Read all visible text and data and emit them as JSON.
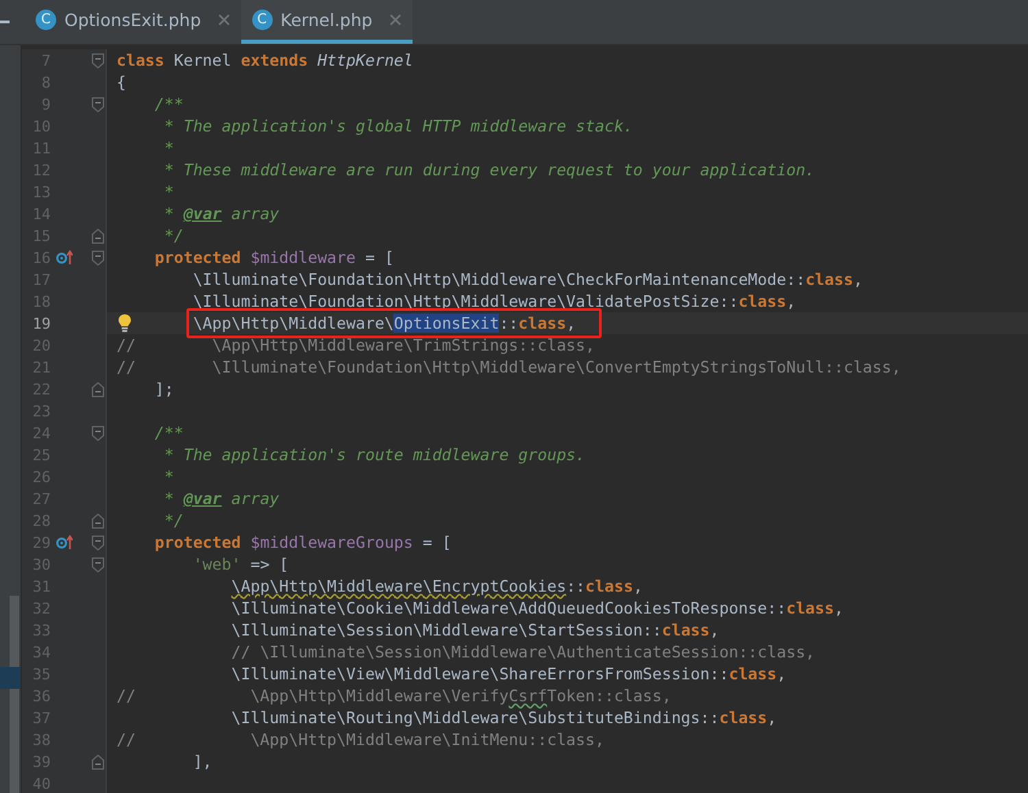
{
  "tabs": [
    {
      "icon_letter": "C",
      "label": "OptionsExit.php",
      "selected": false
    },
    {
      "icon_letter": "C",
      "label": "Kernel.php",
      "selected": true
    }
  ],
  "editor": {
    "lines": [
      {
        "number": "7",
        "fold_start": true,
        "tokens": [
          {
            "kind": "keyword",
            "text": "class"
          },
          {
            "kind": "plain",
            "text": " Kernel "
          },
          {
            "kind": "keyword",
            "text": "extends "
          },
          {
            "kind": "type",
            "text": "HttpKernel"
          }
        ]
      },
      {
        "number": "8",
        "tokens": [
          {
            "kind": "plain",
            "text": "{"
          }
        ]
      },
      {
        "number": "9",
        "fold_start": true,
        "tokens": [
          {
            "kind": "doc",
            "text": "    /**"
          }
        ]
      },
      {
        "number": "10",
        "tokens": [
          {
            "kind": "doc",
            "text": "     * The application's global HTTP middleware stack."
          }
        ]
      },
      {
        "number": "11",
        "tokens": [
          {
            "kind": "doc",
            "text": "     *"
          }
        ]
      },
      {
        "number": "12",
        "tokens": [
          {
            "kind": "doc",
            "text": "     * These middleware are run during every request to your application."
          }
        ]
      },
      {
        "number": "13",
        "tokens": [
          {
            "kind": "doc",
            "text": "     *"
          }
        ]
      },
      {
        "number": "14",
        "tokens": [
          {
            "kind": "doc",
            "text": "     * "
          },
          {
            "kind": "doctag",
            "text": "@var"
          },
          {
            "kind": "doc",
            "text": " array"
          }
        ]
      },
      {
        "number": "15",
        "fold_end": true,
        "tokens": [
          {
            "kind": "doc",
            "text": "     */"
          }
        ]
      },
      {
        "number": "16",
        "fold_start": true,
        "override": true,
        "tokens": [
          {
            "kind": "keyword",
            "text": "    protected "
          },
          {
            "kind": "variable",
            "text": "$middleware"
          },
          {
            "kind": "plain",
            "text": " = ["
          }
        ]
      },
      {
        "number": "17",
        "tokens": [
          {
            "kind": "plain",
            "text": "        \\Illuminate\\Foundation\\Http\\Middleware\\CheckForMaintenanceMode::"
          },
          {
            "kind": "keyword",
            "text": "class"
          },
          {
            "kind": "plain",
            "text": ","
          }
        ]
      },
      {
        "number": "18",
        "tokens": [
          {
            "kind": "plain",
            "text": "        \\Illuminate\\Foundation\\Http\\Middleware\\ValidatePostSize::"
          },
          {
            "kind": "keyword",
            "text": "class"
          },
          {
            "kind": "plain",
            "text": ","
          }
        ]
      },
      {
        "number": "19",
        "current": true,
        "annotated": true,
        "bulb": true,
        "tokens": [
          {
            "kind": "plain",
            "text": "        \\App\\Http\\Middleware\\"
          },
          {
            "kind": "selection",
            "text": "OptionsExit"
          },
          {
            "kind": "plain",
            "text": "::"
          },
          {
            "kind": "keyword",
            "text": "class"
          },
          {
            "kind": "plain",
            "text": ","
          }
        ]
      },
      {
        "number": "20",
        "tokens": [
          {
            "kind": "comment",
            "text": "//        \\App\\Http\\Middleware\\TrimStrings::class,"
          }
        ]
      },
      {
        "number": "21",
        "tokens": [
          {
            "kind": "comment",
            "text": "//        \\Illuminate\\Foundation\\Http\\Middleware\\ConvertEmptyStringsToNull::class,"
          }
        ]
      },
      {
        "number": "22",
        "fold_end": true,
        "tokens": [
          {
            "kind": "plain",
            "text": "    ];"
          }
        ]
      },
      {
        "number": "23"
      },
      {
        "number": "24",
        "fold_start": true,
        "tokens": [
          {
            "kind": "doc",
            "text": "    /**"
          }
        ]
      },
      {
        "number": "25",
        "tokens": [
          {
            "kind": "doc",
            "text": "     * The application's route middleware groups."
          }
        ]
      },
      {
        "number": "26",
        "tokens": [
          {
            "kind": "doc",
            "text": "     *"
          }
        ]
      },
      {
        "number": "27",
        "tokens": [
          {
            "kind": "doc",
            "text": "     * "
          },
          {
            "kind": "doctag",
            "text": "@var"
          },
          {
            "kind": "doc",
            "text": " array"
          }
        ]
      },
      {
        "number": "28",
        "fold_end": true,
        "tokens": [
          {
            "kind": "doc",
            "text": "     */"
          }
        ]
      },
      {
        "number": "29",
        "fold_start": true,
        "override": true,
        "tokens": [
          {
            "kind": "keyword",
            "text": "    protected "
          },
          {
            "kind": "variable",
            "text": "$middlewareGroups"
          },
          {
            "kind": "plain",
            "text": " = ["
          }
        ]
      },
      {
        "number": "30",
        "fold_start": true,
        "tokens": [
          {
            "kind": "string",
            "text": "        'web'"
          },
          {
            "kind": "plain",
            "text": " => ["
          }
        ]
      },
      {
        "number": "31",
        "tokens": [
          {
            "kind": "warn",
            "text": "            \\App\\Http\\Middleware\\EncryptCookies"
          },
          {
            "kind": "plain",
            "text": "::"
          },
          {
            "kind": "keyword",
            "text": "class"
          },
          {
            "kind": "plain",
            "text": ","
          }
        ]
      },
      {
        "number": "32",
        "tokens": [
          {
            "kind": "plain",
            "text": "            \\Illuminate\\Cookie\\Middleware\\AddQueuedCookiesToResponse::"
          },
          {
            "kind": "keyword",
            "text": "class"
          },
          {
            "kind": "plain",
            "text": ","
          }
        ]
      },
      {
        "number": "33",
        "tokens": [
          {
            "kind": "plain",
            "text": "            \\Illuminate\\Session\\Middleware\\StartSession::"
          },
          {
            "kind": "keyword",
            "text": "class"
          },
          {
            "kind": "plain",
            "text": ","
          }
        ]
      },
      {
        "number": "34",
        "tokens": [
          {
            "kind": "comment",
            "text": "            // \\Illuminate\\Session\\Middleware\\AuthenticateSession::class,"
          }
        ]
      },
      {
        "number": "35",
        "tokens": [
          {
            "kind": "plain",
            "text": "            \\Illuminate\\View\\Middleware\\ShareErrorsFromSession::"
          },
          {
            "kind": "keyword",
            "text": "class"
          },
          {
            "kind": "plain",
            "text": ","
          }
        ]
      },
      {
        "number": "36",
        "tokens": [
          {
            "kind": "comment",
            "text": "//            \\App\\Http\\Middleware\\Verify"
          },
          {
            "kind": "typo",
            "text": "Csrf"
          },
          {
            "kind": "comment",
            "text": "Token::class,"
          }
        ]
      },
      {
        "number": "37",
        "tokens": [
          {
            "kind": "plain",
            "text": "            \\Illuminate\\Routing\\Middleware\\SubstituteBindings::"
          },
          {
            "kind": "keyword",
            "text": "class"
          },
          {
            "kind": "plain",
            "text": ","
          }
        ]
      },
      {
        "number": "38",
        "tokens": [
          {
            "kind": "comment",
            "text": "//            \\App\\Http\\Middleware\\InitMenu::class,"
          }
        ]
      },
      {
        "number": "39",
        "fold_end": true,
        "tokens": [
          {
            "kind": "plain",
            "text": "        ],"
          }
        ]
      },
      {
        "number": "40"
      }
    ]
  }
}
